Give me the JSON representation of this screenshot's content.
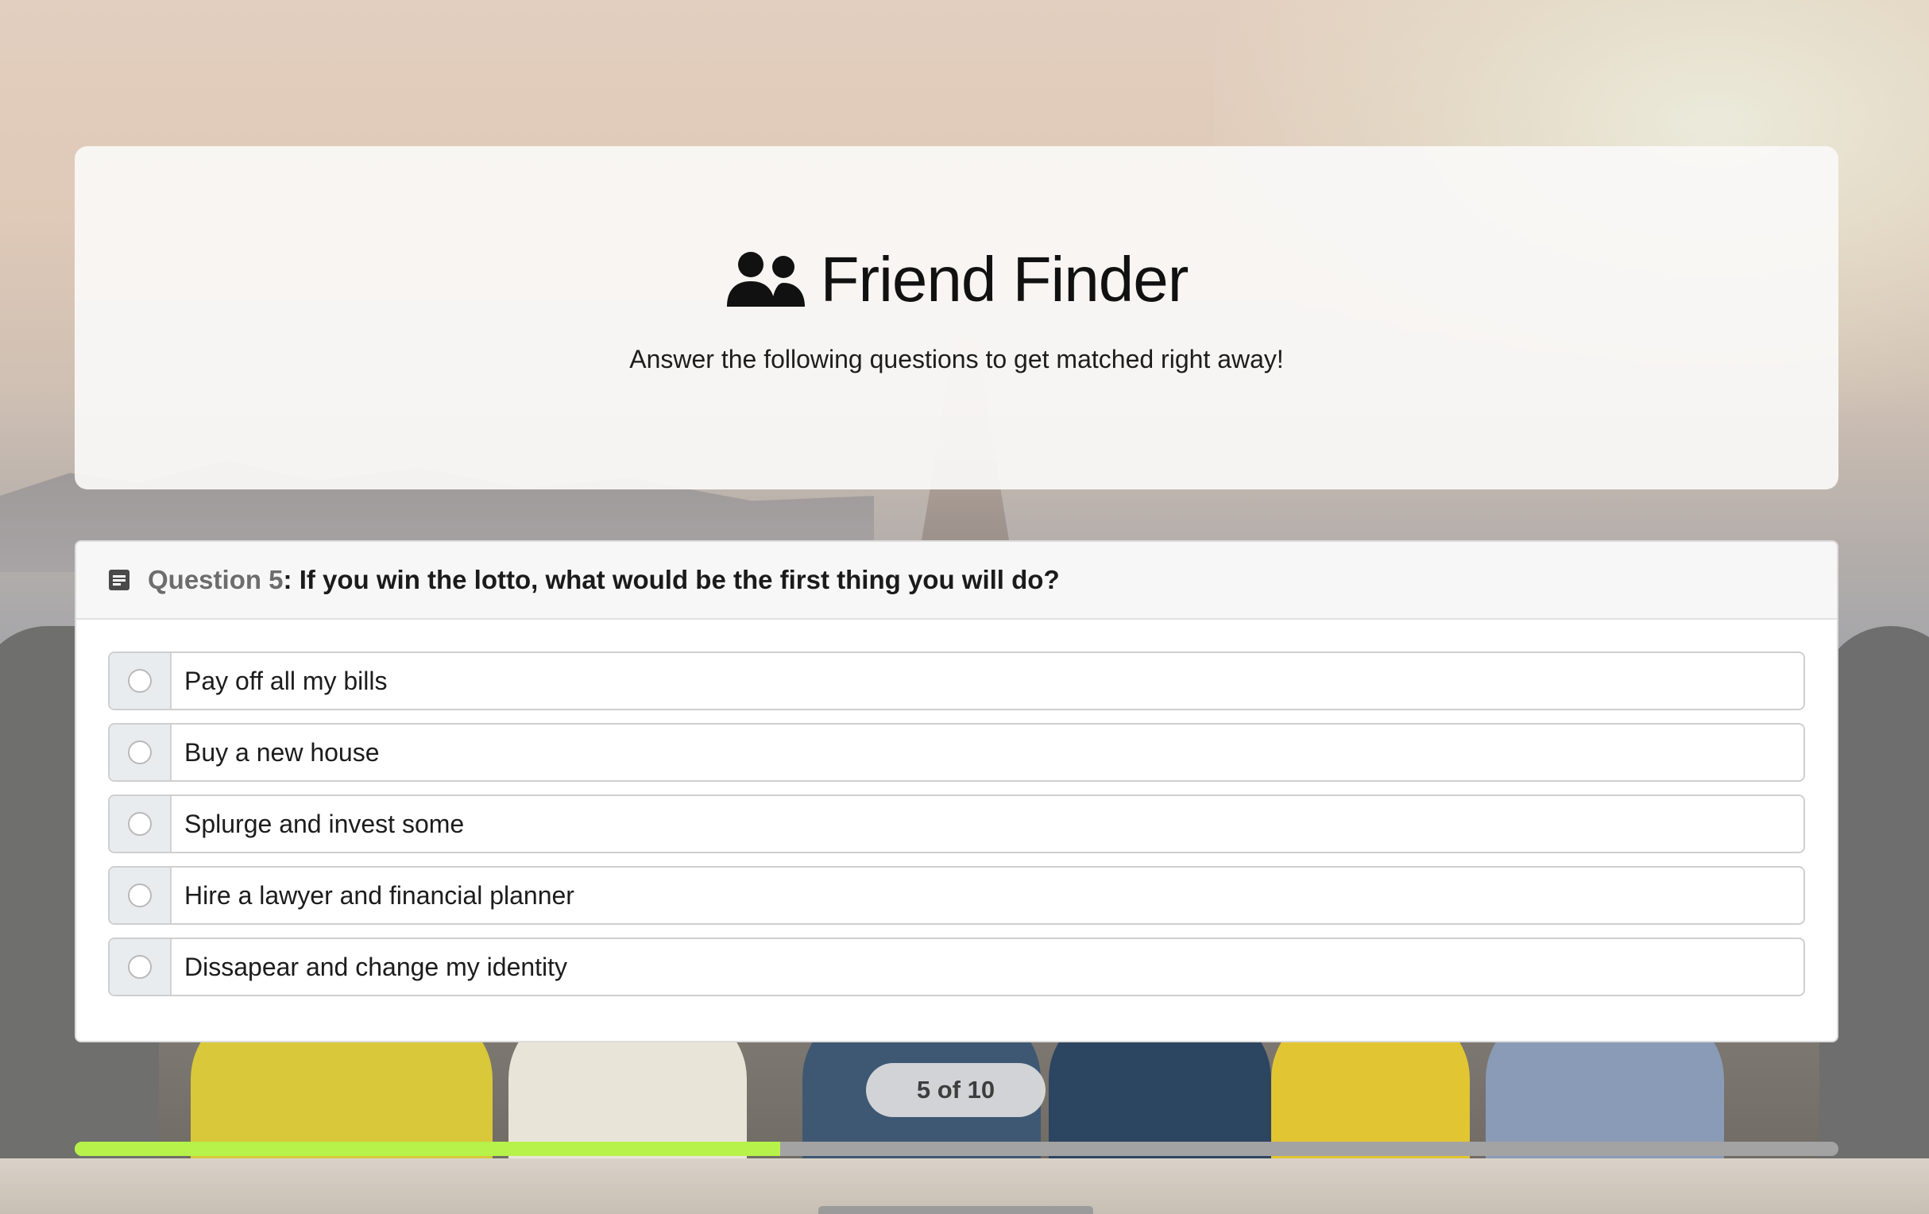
{
  "header": {
    "icon": "users-icon",
    "title": "Friend Finder",
    "subtitle": "Answer the following questions to get matched right away!"
  },
  "question": {
    "icon": "form-icon",
    "number_label": "Question 5",
    "text": ": If you win the lotto, what would be the first thing you will do?",
    "options": [
      {
        "label": "Pay off all my bills",
        "selected": false
      },
      {
        "label": "Buy a new house",
        "selected": false
      },
      {
        "label": "Splurge and invest some",
        "selected": false
      },
      {
        "label": "Hire a lawyer and financial planner",
        "selected": false
      },
      {
        "label": "Dissapear and change my identity",
        "selected": false
      }
    ]
  },
  "progress": {
    "label": "5 of 10",
    "current": 5,
    "total": 10,
    "fraction": 0.4,
    "fill_color": "#b6f24a",
    "track_color": "#a3a3a3"
  }
}
